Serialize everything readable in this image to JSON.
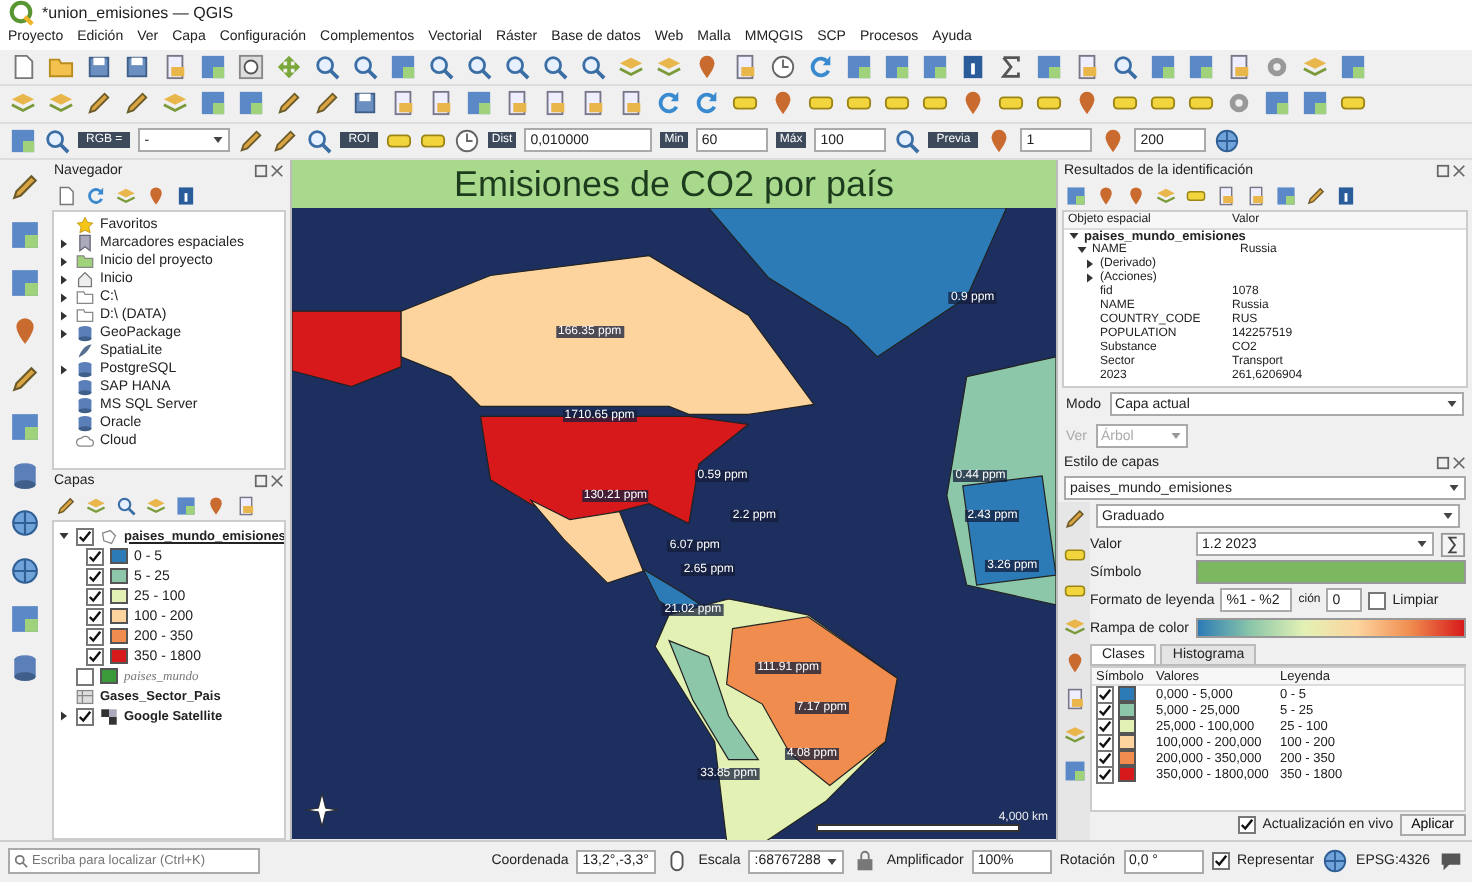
{
  "window": {
    "title": "*union_emisiones — QGIS"
  },
  "menu": [
    "Proyecto",
    "Edición",
    "Ver",
    "Capa",
    "Configuración",
    "Complementos",
    "Vectorial",
    "Ráster",
    "Base de datos",
    "Web",
    "Malla",
    "MMQGIS",
    "SCP",
    "Procesos",
    "Ayuda"
  ],
  "scp_toolbar": {
    "band_set": "RGB =",
    "band_value": "-",
    "roi_label": "ROI",
    "dist_label": "Dist",
    "dist": "0,010000",
    "min_label": "Min",
    "min": "60",
    "max_label": "Máx",
    "max": "100",
    "preview_label": "Previa",
    "t_value": "1",
    "range_to": "200"
  },
  "navigator": {
    "title": "Navegador",
    "items": [
      {
        "kind": "star",
        "label": "Favoritos"
      },
      {
        "kind": "bookmark",
        "label": "Marcadores espaciales",
        "expanded": false
      },
      {
        "kind": "project",
        "label": "Inicio del proyecto",
        "expanded": false
      },
      {
        "kind": "home",
        "label": "Inicio",
        "expanded": false
      },
      {
        "kind": "drive",
        "label": "C:\\",
        "expanded": false
      },
      {
        "kind": "drive",
        "label": "D:\\ (DATA)",
        "expanded": false
      },
      {
        "kind": "geopackage",
        "label": "GeoPackage",
        "expanded": false
      },
      {
        "kind": "spatialite",
        "label": "SpatiaLite"
      },
      {
        "kind": "postgres",
        "label": "PostgreSQL",
        "expanded": false
      },
      {
        "kind": "hana",
        "label": "SAP HANA"
      },
      {
        "kind": "mssql",
        "label": "MS SQL Server"
      },
      {
        "kind": "oracle",
        "label": "Oracle"
      },
      {
        "kind": "cloud",
        "label": "Cloud"
      }
    ]
  },
  "layers_panel": {
    "title": "Capas",
    "layers": [
      {
        "kind": "vector",
        "name": "paises_mundo_emisiones",
        "checked": true,
        "selected": true,
        "expanded": true,
        "classes": [
          {
            "label": "0 - 5",
            "color": "#2c7bb6",
            "checked": true
          },
          {
            "label": "5 - 25",
            "color": "#8cc7a9",
            "checked": true
          },
          {
            "label": "25 - 100",
            "color": "#e3f1b4",
            "checked": true
          },
          {
            "label": "100 - 200",
            "color": "#fdd49e",
            "checked": true
          },
          {
            "label": "200 - 350",
            "color": "#f08c4e",
            "checked": true
          },
          {
            "label": "350 - 1800",
            "color": "#d7191c",
            "checked": true
          }
        ]
      },
      {
        "kind": "vector-fill",
        "name": "paises_mundo",
        "checked": false,
        "selected": false
      },
      {
        "kind": "table",
        "name": "Gases_Sector_Pais",
        "selected": false
      },
      {
        "kind": "raster",
        "name": "Google Satellite",
        "checked": true,
        "selected": false,
        "expanded": false
      }
    ]
  },
  "map": {
    "title": "Emisiones de CO2 por país",
    "labels": [
      "166.35 ppm",
      "1710.65 ppm",
      "0.9 ppm",
      "130.21 ppm",
      "0.59 ppm",
      "2.2 ppm",
      "0.44 ppm",
      "2.43 ppm",
      "3.26 ppm",
      "6.07 ppm",
      "2.65 ppm",
      "21.02 ppm",
      "111.91 ppm",
      "7.17 ppm",
      "4.08 ppm",
      "33.85 ppm"
    ],
    "scale_label": "4,000 km"
  },
  "identify": {
    "title": "Resultados de la identificación",
    "columns": [
      "Objeto espacial",
      "Valor"
    ],
    "tree": [
      {
        "field": "paises_mundo_emisiones",
        "kind": "layer",
        "expanded": true,
        "children": [
          {
            "field": "NAME",
            "value": "Russia",
            "expanded": true,
            "children": [
              {
                "field": "(Derivado)",
                "expanded": false
              },
              {
                "field": "(Acciones)",
                "expanded": false
              },
              {
                "field": "fid",
                "value": "1078"
              },
              {
                "field": "NAME",
                "value": "Russia"
              },
              {
                "field": "COUNTRY_CODE",
                "value": "RUS"
              },
              {
                "field": "POPULATION",
                "value": "142257519"
              },
              {
                "field": "Substance",
                "value": "CO2"
              },
              {
                "field": "Sector",
                "value": "Transport"
              },
              {
                "field": "2023",
                "value": "261,6206904"
              }
            ]
          }
        ]
      }
    ],
    "mode_label": "Modo",
    "mode": "Capa actual",
    "view_label": "Ver",
    "view": "Árbol",
    "view_disabled": true
  },
  "style": {
    "title": "Estilo de capas",
    "layer": "paises_mundo_emisiones",
    "renderer": "Graduado",
    "value_label": "Valor",
    "value": "1.2 2023",
    "symbol_label": "Símbolo",
    "legend_format_label": "Formato de leyenda",
    "legend_format": "%1 - %2",
    "precision_label": "ción",
    "precision": "0",
    "trim_label": "Limpiar",
    "trim": false,
    "ramp_label": "Rampa de color",
    "tabs": [
      {
        "label": "Clases",
        "selected": true
      },
      {
        "label": "Histograma",
        "selected": false
      }
    ],
    "columns": [
      "Símbolo",
      "Valores",
      "Leyenda"
    ],
    "classes": [
      {
        "checked": true,
        "color": "#2c7bb6",
        "values": "0,000 - 5,000",
        "legend": "0 - 5"
      },
      {
        "checked": true,
        "color": "#8cc7a9",
        "values": "5,000 - 25,000",
        "legend": "5 - 25"
      },
      {
        "checked": true,
        "color": "#e3f1b4",
        "values": "25,000 - 100,000",
        "legend": "25 - 100"
      },
      {
        "checked": true,
        "color": "#fdd49e",
        "values": "100,000 - 200,000",
        "legend": "100 - 200"
      },
      {
        "checked": true,
        "color": "#f08c4e",
        "values": "200,000 - 350,000",
        "legend": "200 - 350"
      },
      {
        "checked": true,
        "color": "#d7191c",
        "values": "350,000 - 1800,000",
        "legend": "350 - 1800"
      }
    ],
    "live_update_label": "Actualización en vivo",
    "live_update": true,
    "apply": "Aplicar"
  },
  "status_bar": {
    "search_placeholder": "Escriba para localizar (Ctrl+K)",
    "coord_label": "Coordenada",
    "coord": "13,2°,-3,3°",
    "scale_label": "Escala",
    "scale": ":68767288",
    "magnifier_label": "Amplificador",
    "magnifier": "100%",
    "rotation_label": "Rotación",
    "rotation": "0,0 °",
    "render_label": "Representar",
    "render": true,
    "crs": "EPSG:4326"
  }
}
